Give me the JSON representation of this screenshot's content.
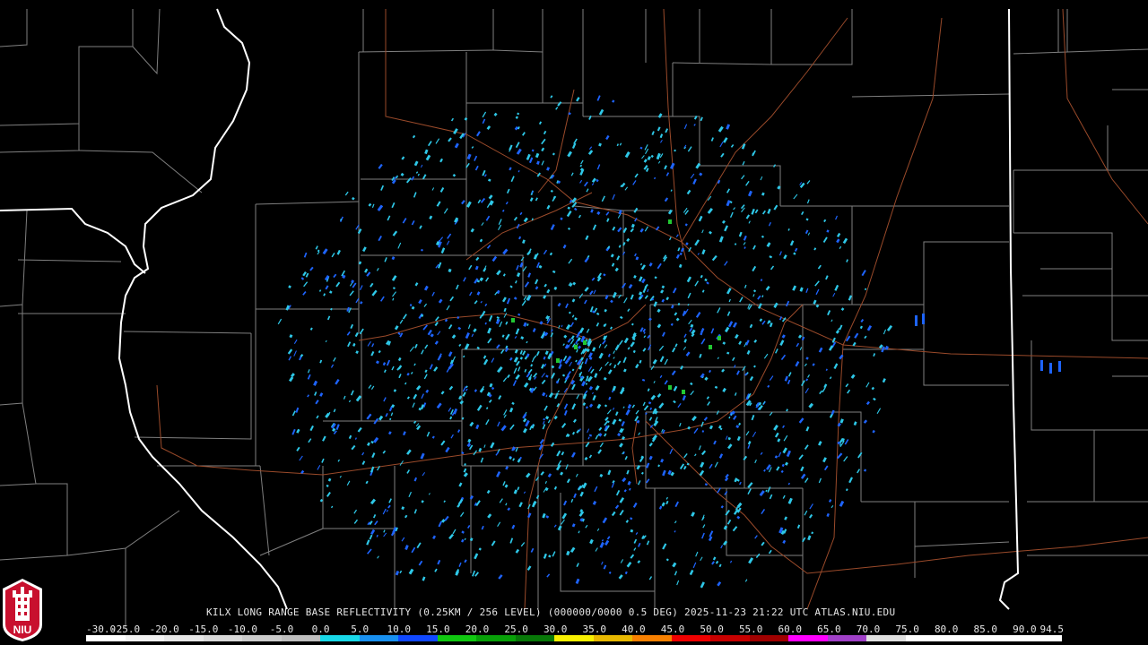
{
  "radar": {
    "title": "KILX LONG RANGE BASE REFLECTIVITY (0.25KM / 256 LEVEL) (000000/0000 0.5 DEG) 2025-11-23 21:22 UTC  ATLAS.NIU.EDU",
    "logo_text": "NIU"
  },
  "colors": {
    "background": "#000000",
    "county_border": "#7f7f7f",
    "state_border": "#ffffff",
    "highway": "#9a4a2a",
    "logo_red": "#c8102e",
    "echo_cyan": "#2ec8e8",
    "echo_blue": "#1e64ff",
    "echo_green": "#22c832"
  },
  "color_scale": {
    "labels": [
      "-30.0",
      "-25.0",
      "-20.0",
      "-15.0",
      "-10.0",
      "-5.0",
      "0.0",
      "5.0",
      "10.0",
      "15.0",
      "20.0",
      "25.0",
      "30.0",
      "35.0",
      "40.0",
      "45.0",
      "50.0",
      "55.0",
      "60.0",
      "65.0",
      "70.0",
      "75.0",
      "80.0",
      "85.0",
      "90.0",
      "94.5"
    ],
    "segment_colors": [
      "#ffffff",
      "#f2f2f2",
      "#e6e6e6",
      "#d9d9d9",
      "#cccccc",
      "#bfbfbf",
      "#18d8e8",
      "#1890f0",
      "#1048ff",
      "#10c810",
      "#08a008",
      "#087808",
      "#f8f000",
      "#e8b800",
      "#f88000",
      "#f00000",
      "#c80000",
      "#a00000",
      "#ff00ff",
      "#a040c8",
      "#e0e0e0",
      "#ffffff",
      "#ffffff",
      "#ffffff",
      "#ffffff"
    ]
  }
}
